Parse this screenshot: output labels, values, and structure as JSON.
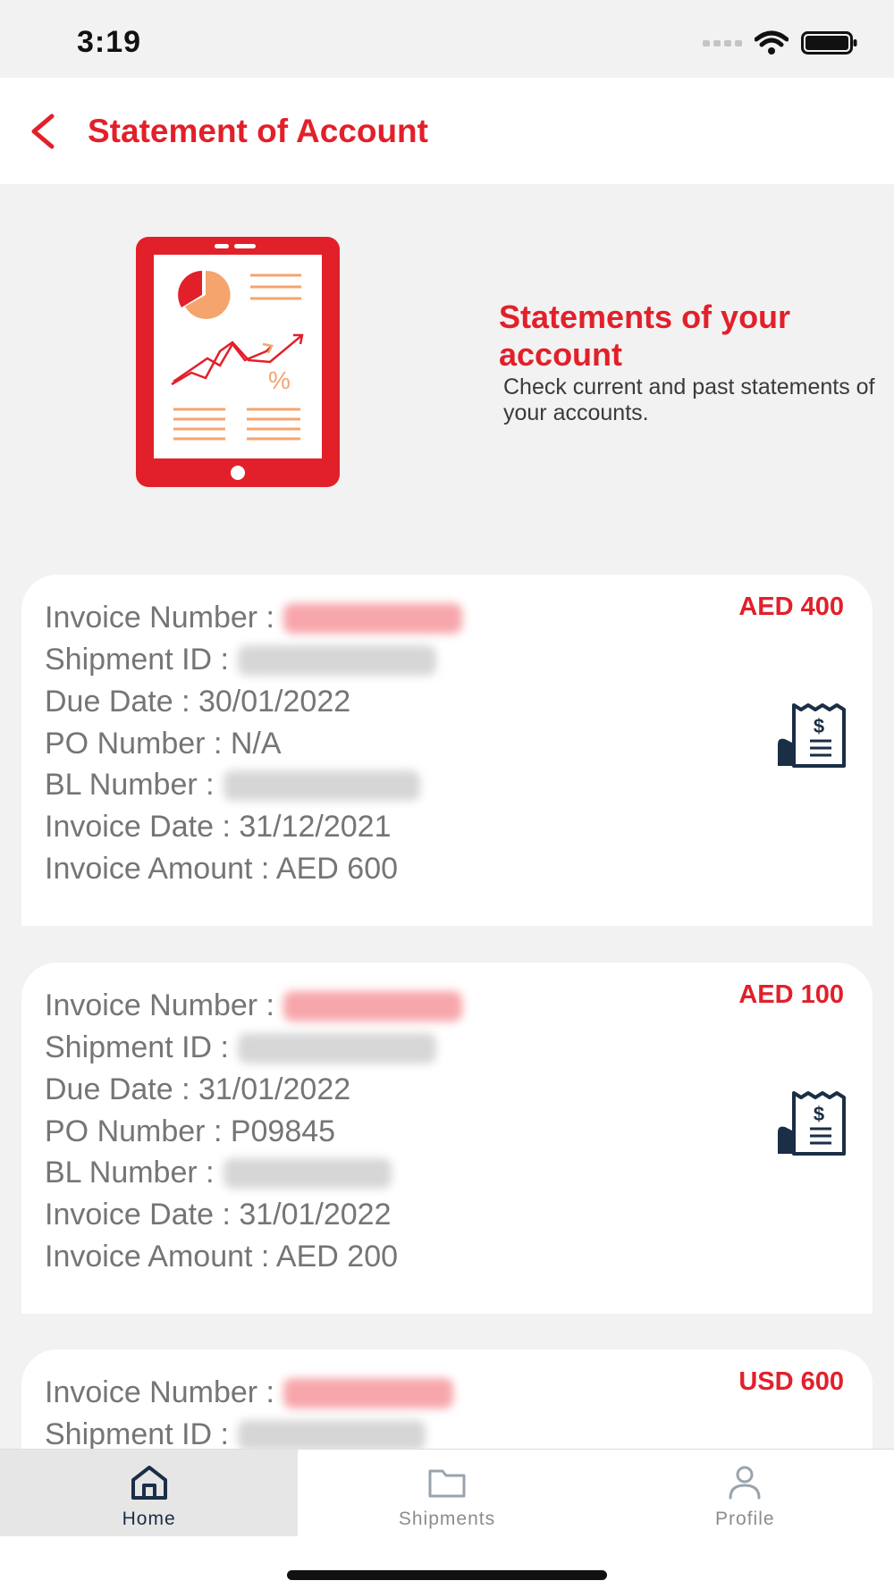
{
  "status_bar": {
    "time": "3:19"
  },
  "header": {
    "title": "Statement of Account"
  },
  "banner": {
    "title": "Statements of your account",
    "subtitle": "Check current and past statements of your accounts."
  },
  "invoices": [
    {
      "amount": "AED 400",
      "invoice_number_label": "Invoice Number :",
      "shipment_id_label": "Shipment ID :",
      "due_date": "Due Date : 30/01/2022",
      "po_number": "PO Number : N/A",
      "bl_number_label": "BL Number :",
      "invoice_date": "Invoice Date : 31/12/2021",
      "invoice_amount": "Invoice Amount : AED 600"
    },
    {
      "amount": "AED 100",
      "invoice_number_label": "Invoice Number :",
      "shipment_id_label": "Shipment ID :",
      "due_date": "Due Date : 31/01/2022",
      "po_number": "PO Number : P09845",
      "bl_number_label": "BL Number :",
      "invoice_date": "Invoice Date : 31/01/2022",
      "invoice_amount": "Invoice Amount : AED 200"
    },
    {
      "amount": "USD 600",
      "invoice_number_label": "Invoice Number :",
      "shipment_id_label": "Shipment ID :"
    }
  ],
  "tabbar": {
    "items": [
      {
        "label": "Home",
        "icon": "home-icon",
        "active": true
      },
      {
        "label": "Shipments",
        "icon": "folder-icon",
        "active": false
      },
      {
        "label": "Profile",
        "icon": "user-icon",
        "active": false
      }
    ]
  },
  "colors": {
    "brand_red": "#e2202a",
    "accent_orange": "#f5a46e",
    "icon_navy": "#1a2e45"
  }
}
